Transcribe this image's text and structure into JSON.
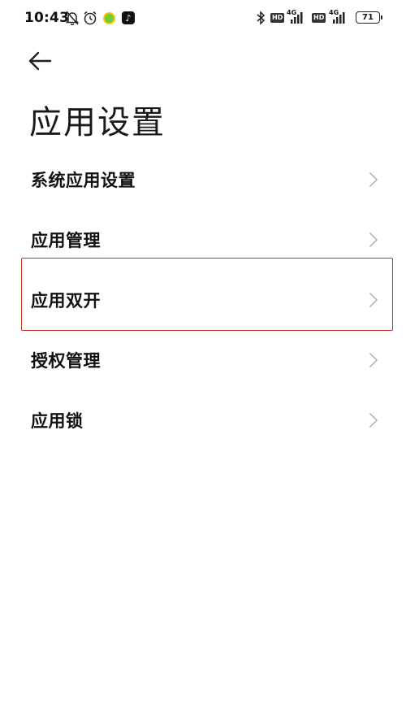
{
  "status_bar": {
    "time": "10:43",
    "network_1": "4G",
    "network_2": "4G",
    "hd_1": "HD",
    "hd_2": "HD",
    "battery": "71",
    "tiktok_glyph": "♪",
    "icons": [
      "bell-muted-icon",
      "alarm-clock-icon",
      "green-app-icon",
      "tiktok-icon",
      "bluetooth-icon",
      "signal-icon",
      "signal-icon",
      "battery-icon"
    ]
  },
  "header": {
    "title": "应用设置"
  },
  "list": {
    "items": [
      {
        "label": "系统应用设置"
      },
      {
        "label": "应用管理"
      },
      {
        "label": "应用双开"
      },
      {
        "label": "授权管理"
      },
      {
        "label": "应用锁"
      }
    ]
  },
  "colors": {
    "highlight_border": "#c0392b",
    "chevron": "#b5b5b5",
    "background": "#ffffff"
  }
}
